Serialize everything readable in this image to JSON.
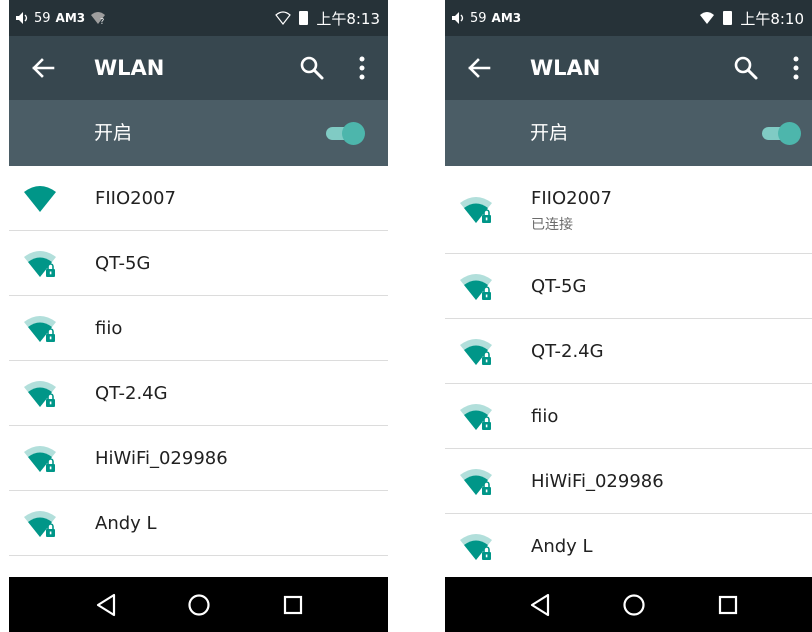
{
  "colors": {
    "statusbar": "#263238",
    "appbar": "#37474f",
    "toggle_bar": "#4b5d66",
    "accent": "#009688",
    "switch_thumb": "#4db6ac",
    "navbar": "#000000"
  },
  "left": {
    "statusbar": {
      "volume_icon": "speaker-icon",
      "volume_level": "59",
      "carrier": "AM3",
      "wifi_symbol": "?",
      "time": "上午8:13"
    },
    "appbar": {
      "title": "WLAN"
    },
    "toggle": {
      "label": "开启",
      "state": "on"
    },
    "networks": [
      {
        "name": "FIIO2007",
        "secured": false
      },
      {
        "name": "QT-5G",
        "secured": true
      },
      {
        "name": "fiio",
        "secured": true
      },
      {
        "name": "QT-2.4G",
        "secured": true
      },
      {
        "name": "HiWiFi_029986",
        "secured": true
      },
      {
        "name": "Andy L",
        "secured": true
      }
    ]
  },
  "right": {
    "statusbar": {
      "volume_icon": "speaker-icon",
      "volume_level": "59",
      "carrier": "AM3",
      "time": "上午8:10"
    },
    "appbar": {
      "title": "WLAN"
    },
    "toggle": {
      "label": "开启",
      "state": "on"
    },
    "networks": [
      {
        "name": "FIIO2007",
        "status": "已连接",
        "secured": true
      },
      {
        "name": "QT-5G",
        "secured": true
      },
      {
        "name": "QT-2.4G",
        "secured": true
      },
      {
        "name": "fiio",
        "secured": true
      },
      {
        "name": "HiWiFi_029986",
        "secured": true
      },
      {
        "name": "Andy L",
        "secured": true
      }
    ]
  }
}
